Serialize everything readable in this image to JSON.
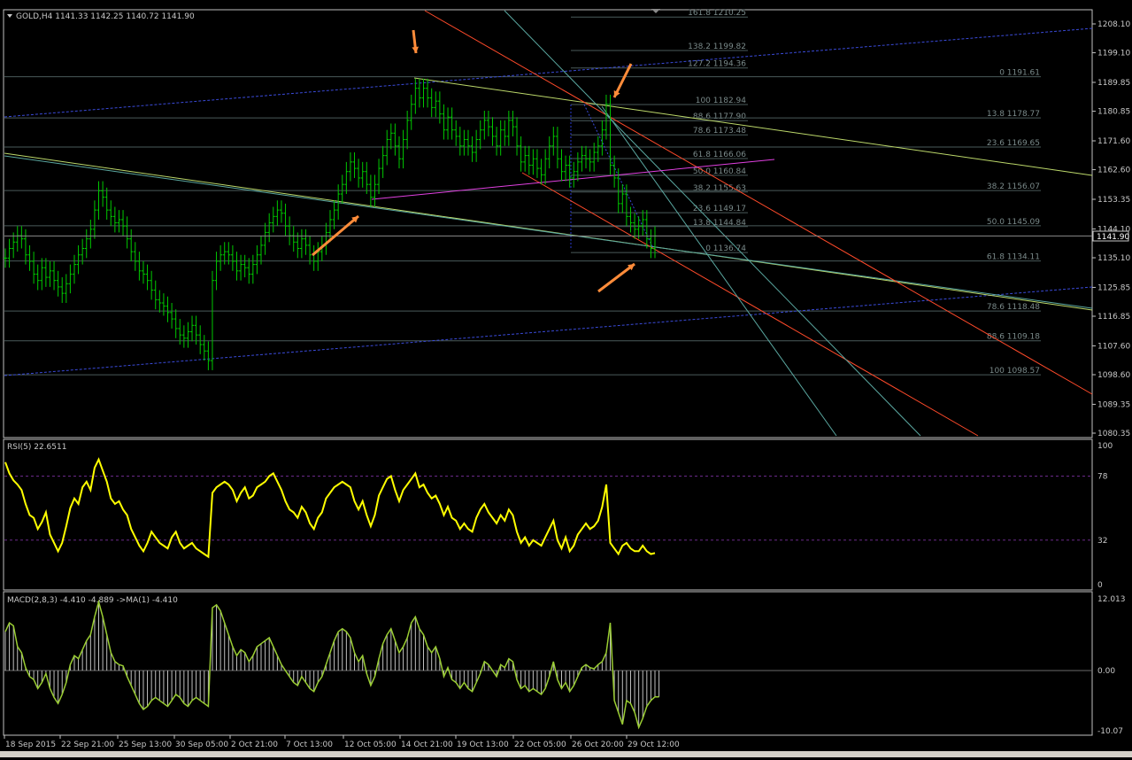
{
  "symbol_header": "GOLD,H4  1141.33 1142.25 1140.72 1141.90",
  "current_price": "1141.90",
  "colors": {
    "bg": "#000000",
    "candle": "#00c800",
    "grid": "#4a5a5a",
    "rsi_line": "#ffff00",
    "macd_line": "#9acd32",
    "macd_hist": "#c0c0c0",
    "trend_green": "#bcd86a",
    "trend_red": "#ff4a2a",
    "trend_cyan": "#5aa7a0",
    "trend_blue": "#3a4ad8",
    "trend_magenta": "#e040e0",
    "arrow": "#ff8c3a"
  },
  "price_axis": [
    "1208.10",
    "1199.10",
    "1189.85",
    "1180.85",
    "1171.60",
    "1162.60",
    "1153.35",
    "1144.10",
    "1135.10",
    "1125.85",
    "1116.85",
    "1107.60",
    "1098.60",
    "1089.35",
    "1080.35"
  ],
  "fib_short": [
    {
      "label": "161.8 1210.25"
    },
    {
      "label": "138.2 1199.82"
    },
    {
      "label": "127.2 1194.36"
    },
    {
      "label": "100 1182.94"
    },
    {
      "label": "88.6 1177.90"
    },
    {
      "label": "78.6 1173.48"
    },
    {
      "label": "61.8 1166.06"
    },
    {
      "label": "50.0 1160.84"
    },
    {
      "label": "38.2 1155.63"
    },
    {
      "label": "23.6 1149.17"
    },
    {
      "label": "13.8 1144.84"
    },
    {
      "label": "0 1136.74"
    }
  ],
  "fib_long": [
    {
      "label": "0 1191.61"
    },
    {
      "label": "13.8 1178.77"
    },
    {
      "label": "23.6 1169.65"
    },
    {
      "label": "38.2 1156.07"
    },
    {
      "label": "50.0 1145.09"
    },
    {
      "label": "61.8 1134.11"
    },
    {
      "label": "78.6 1118.48"
    },
    {
      "label": "88.6 1109.18"
    },
    {
      "label": "100 1098.57"
    }
  ],
  "rsi": {
    "header": "RSI(5) 22.6511",
    "levels": [
      "100",
      "78",
      "32",
      "0"
    ]
  },
  "macd": {
    "header": "MACD(2,8,3) -4.410 -4.889  ->MA(1) -4.410",
    "levels": [
      "12.013",
      "0.00",
      "-10.07"
    ]
  },
  "time_axis": [
    "18 Sep 2015",
    "22 Sep 21:00",
    "25 Sep 13:00",
    "30 Sep 05:00",
    "2 Oct 21:00",
    "7 Oct 13:00",
    "12 Oct 05:00",
    "14 Oct 21:00",
    "19 Oct 13:00",
    "22 Oct 05:00",
    "26 Oct 20:00",
    "29 Oct 12:00"
  ],
  "chart_data": {
    "type": "line",
    "title": "GOLD,H4",
    "price_range": [
      1080.35,
      1208.1
    ],
    "closes": [
      1135,
      1138,
      1140,
      1142,
      1141,
      1136,
      1134,
      1130,
      1128,
      1132,
      1129,
      1131,
      1128,
      1126,
      1124,
      1127,
      1130,
      1133,
      1136,
      1138,
      1141,
      1144,
      1150,
      1156,
      1154,
      1150,
      1148,
      1146,
      1147,
      1145,
      1141,
      1137,
      1134,
      1131,
      1130,
      1128,
      1125,
      1122,
      1121,
      1120,
      1118,
      1116,
      1113,
      1111,
      1110,
      1112,
      1114,
      1111,
      1108,
      1106,
      1103,
      1128,
      1134,
      1136,
      1137,
      1136,
      1134,
      1131,
      1133,
      1132,
      1130,
      1133,
      1136,
      1139,
      1143,
      1146,
      1148,
      1150,
      1149,
      1145,
      1142,
      1140,
      1138,
      1141,
      1139,
      1136,
      1134,
      1137,
      1139,
      1143,
      1147,
      1150,
      1155,
      1158,
      1162,
      1165,
      1163,
      1160,
      1162,
      1158,
      1154,
      1158,
      1163,
      1167,
      1172,
      1174,
      1170,
      1166,
      1172,
      1178,
      1183,
      1188,
      1185,
      1188,
      1185,
      1182,
      1184,
      1180,
      1175,
      1179,
      1175,
      1173,
      1170,
      1172,
      1170,
      1168,
      1172,
      1175,
      1178,
      1176,
      1173,
      1170,
      1175,
      1173,
      1178,
      1176,
      1170,
      1165,
      1167,
      1164,
      1166,
      1163,
      1161,
      1166,
      1170,
      1173,
      1166,
      1162,
      1164,
      1160,
      1162,
      1165,
      1167,
      1166,
      1165,
      1168,
      1170,
      1175,
      1183,
      1164,
      1160,
      1152,
      1155,
      1148,
      1146,
      1144,
      1145,
      1147,
      1141,
      1138,
      1141.9
    ],
    "rsi_values": [
      88,
      80,
      75,
      72,
      68,
      58,
      50,
      48,
      40,
      45,
      52,
      36,
      30,
      24,
      30,
      42,
      55,
      62,
      58,
      70,
      74,
      68,
      84,
      90,
      82,
      74,
      62,
      58,
      60,
      54,
      50,
      40,
      34,
      28,
      24,
      30,
      38,
      34,
      30,
      28,
      26,
      34,
      38,
      30,
      26,
      28,
      30,
      26,
      24,
      22,
      20,
      66,
      70,
      72,
      74,
      72,
      68,
      60,
      66,
      70,
      62,
      64,
      70,
      72,
      74,
      78,
      80,
      74,
      68,
      60,
      54,
      52,
      48,
      56,
      52,
      44,
      40,
      48,
      52,
      62,
      66,
      70,
      72,
      74,
      72,
      70,
      60,
      54,
      60,
      50,
      42,
      50,
      64,
      70,
      76,
      78,
      68,
      60,
      68,
      72,
      76,
      80,
      70,
      72,
      66,
      62,
      64,
      58,
      50,
      56,
      48,
      46,
      40,
      44,
      40,
      38,
      48,
      54,
      58,
      52,
      48,
      44,
      50,
      46,
      54,
      50,
      38,
      30,
      34,
      28,
      32,
      30,
      28,
      34,
      40,
      46,
      32,
      26,
      34,
      24,
      28,
      36,
      40,
      44,
      40,
      42,
      46,
      56,
      72,
      30,
      26,
      22,
      28,
      30,
      26,
      24,
      24,
      28,
      24,
      22,
      22.65
    ],
    "macd_values": [
      6.5,
      8,
      7.5,
      4,
      3,
      0.5,
      -1,
      -1.5,
      -3,
      -2,
      -0.5,
      -3,
      -4.5,
      -5.5,
      -4,
      -2,
      1,
      2.5,
      2,
      3.5,
      5,
      6,
      9,
      11.5,
      9,
      6,
      3,
      1.5,
      1,
      0.8,
      -1,
      -2.5,
      -4,
      -5.5,
      -6.5,
      -6,
      -5,
      -4.5,
      -5,
      -5.5,
      -6,
      -5,
      -4,
      -4.5,
      -5.5,
      -6,
      -5,
      -4.5,
      -5,
      -5.5,
      -6,
      10.5,
      11,
      10,
      8,
      6,
      4,
      2.5,
      3.5,
      3,
      1.5,
      2.5,
      4,
      4.5,
      5,
      5.5,
      4,
      2.5,
      1,
      0,
      -1,
      -2,
      -2.5,
      -1,
      -2,
      -3,
      -3.5,
      -2,
      -1,
      1,
      3,
      5,
      6.5,
      7,
      6.5,
      5.5,
      3,
      1.5,
      2.5,
      -0.5,
      -2.5,
      -1,
      2,
      4.5,
      6,
      7,
      5,
      3,
      4,
      5.5,
      8,
      9,
      7,
      6,
      4,
      3,
      4,
      2,
      -1,
      0.5,
      -1.5,
      -2,
      -3,
      -2,
      -3,
      -3.5,
      -2,
      -0.5,
      1.5,
      1,
      0,
      -1,
      1,
      0.5,
      2,
      1.5,
      -1.5,
      -3,
      -2.5,
      -3.5,
      -3,
      -3.5,
      -4,
      -3,
      -1,
      1.5,
      -1.5,
      -3,
      -2,
      -3.5,
      -2.5,
      -1,
      0.5,
      1,
      0.5,
      0.3,
      1,
      1.5,
      3,
      8,
      -5,
      -7,
      -9,
      -5,
      -5.5,
      -7,
      -9.5,
      -8,
      -6,
      -5,
      -4.4,
      -4.41
    ],
    "ylim_rsi": [
      0,
      100
    ],
    "ylim_macd": [
      -10.07,
      12.013
    ]
  }
}
